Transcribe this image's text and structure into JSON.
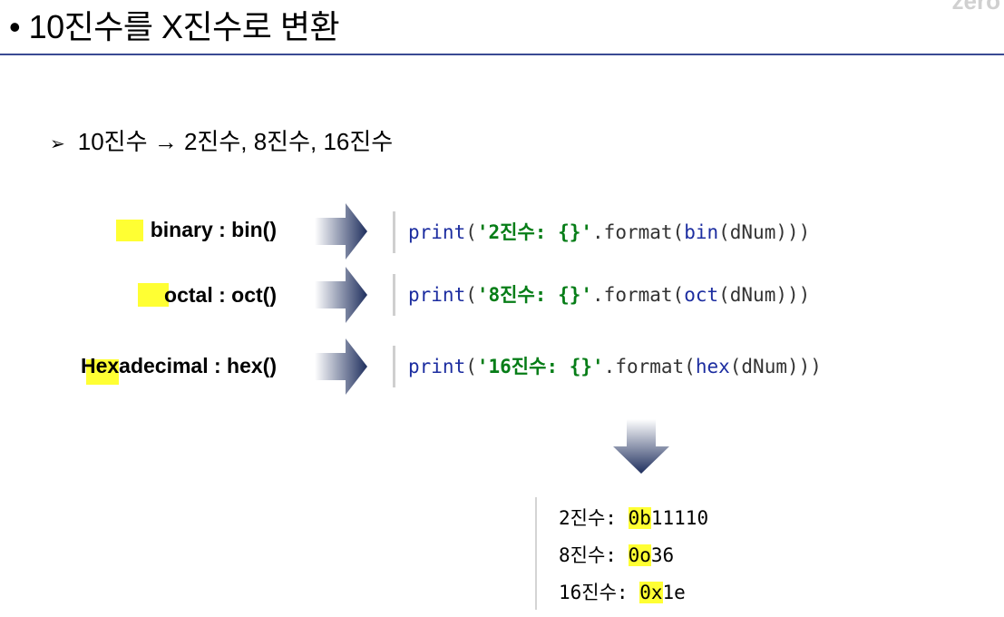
{
  "header": {
    "title": "• 10진수를 X진수로 변환",
    "brand": "zero"
  },
  "subheading": {
    "marker": "➢",
    "text": "10진수 → 2진수, 8진수, 16진수"
  },
  "rows": [
    {
      "label": "binary : bin()",
      "code": {
        "print": "print",
        "open": "(",
        "str": "'2진수: {}'",
        "fmt": ".format(",
        "func": "bin",
        "args": "(dNum)))"
      }
    },
    {
      "label": "octal : oct()",
      "code": {
        "print": "print",
        "open": "(",
        "str": "'8진수: {}'",
        "fmt": ".format(",
        "func": "oct",
        "args": "(dNum)))"
      }
    },
    {
      "label": "Hexadecimal : hex()",
      "code": {
        "print": "print",
        "open": "(",
        "str": "'16진수: {}'",
        "fmt": ".format(",
        "func": "hex",
        "args": "(dNum)))"
      }
    }
  ],
  "output": [
    {
      "label": "2진수: ",
      "prefix": "0b",
      "rest": "11110"
    },
    {
      "label": "8진수: ",
      "prefix": "0o",
      "rest": "36"
    },
    {
      "label": "16진수: ",
      "prefix": "0x",
      "rest": "1e"
    }
  ],
  "colors": {
    "rule": "#3a4a93",
    "highlight": "#ffff33",
    "keyword": "#1c2da0",
    "string": "#067d17"
  },
  "icons": [
    "right-arrow-icon",
    "down-arrow-icon"
  ]
}
